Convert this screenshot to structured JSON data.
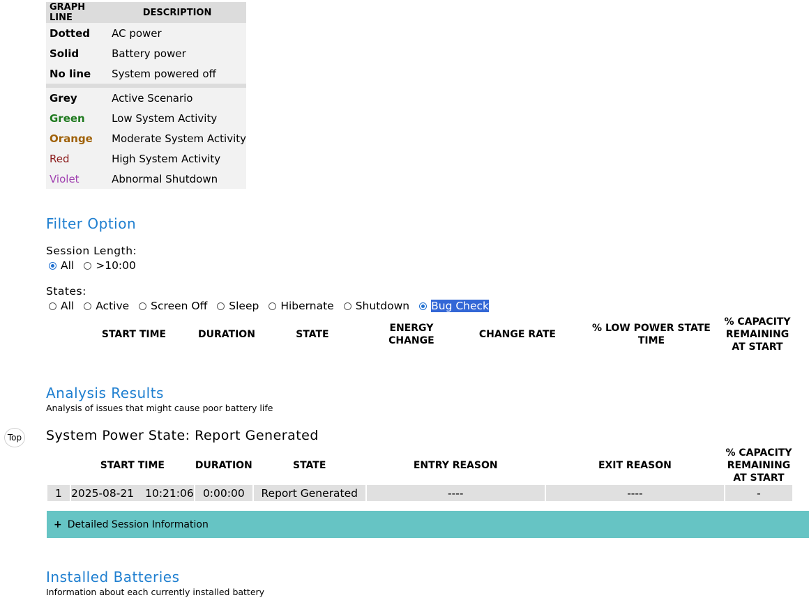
{
  "legend": {
    "headers": [
      "GRAPH LINE",
      "DESCRIPTION"
    ],
    "line_rows": [
      {
        "key": "Dotted",
        "desc": "AC power",
        "color": "#000000"
      },
      {
        "key": "Solid",
        "desc": "Battery power",
        "color": "#000000"
      },
      {
        "key": "No line",
        "desc": "System powered off",
        "color": "#000000"
      }
    ],
    "color_rows": [
      {
        "key": "Grey",
        "desc": "Active Scenario",
        "color": "#000000",
        "weight": "bold"
      },
      {
        "key": "Green",
        "desc": "Low System Activity",
        "color": "#1f7a1f",
        "weight": "bold"
      },
      {
        "key": "Orange",
        "desc": "Moderate System Activity",
        "color": "#a0620a",
        "weight": "bold"
      },
      {
        "key": "Red",
        "desc": "High System Activity",
        "color": "#8b1a1a",
        "weight": "normal"
      },
      {
        "key": "Violet",
        "desc": "Abnormal Shutdown",
        "color": "#a040b0",
        "weight": "normal"
      }
    ]
  },
  "filter": {
    "title": "Filter Option",
    "session_label": "Session Length:",
    "session_options": [
      {
        "label": "All",
        "selected": true,
        "name": "radio-session-all"
      },
      {
        "label": ">10:00",
        "selected": false,
        "name": "radio-session-over-10"
      }
    ],
    "states_label": "States:",
    "state_options": [
      {
        "label": "All",
        "selected": false,
        "name": "radio-state-all"
      },
      {
        "label": "Active",
        "selected": false,
        "name": "radio-state-active"
      },
      {
        "label": "Screen Off",
        "selected": false,
        "name": "radio-state-screen-off"
      },
      {
        "label": "Sleep",
        "selected": false,
        "name": "radio-state-sleep"
      },
      {
        "label": "Hibernate",
        "selected": false,
        "name": "radio-state-hibernate"
      },
      {
        "label": "Shutdown",
        "selected": false,
        "name": "radio-state-shutdown"
      },
      {
        "label": "Bug Check",
        "selected": true,
        "name": "radio-state-bug-check"
      }
    ]
  },
  "usage_table": {
    "headers": [
      "START TIME",
      "DURATION",
      "STATE",
      "ENERGY CHANGE",
      "CHANGE RATE",
      "% LOW POWER STATE TIME",
      "% CAPACITY REMAINING AT START"
    ]
  },
  "analysis": {
    "title": "Analysis Results",
    "subtitle": "Analysis of issues that might cause poor battery life"
  },
  "top_button": "Top",
  "system_power": {
    "title": "System Power State: Report Generated",
    "headers": [
      "START TIME",
      "DURATION",
      "STATE",
      "ENTRY REASON",
      "EXIT REASON",
      "% CAPACITY REMAINING AT START"
    ],
    "rows": [
      {
        "index": "1",
        "date": "2025-08-21",
        "time": "10:21:06",
        "duration": "0:00:00",
        "state": "Report Generated",
        "entry": "----",
        "exit": "----",
        "capacity": "-"
      }
    ]
  },
  "details": {
    "icon": "+",
    "label": "Detailed Session Information",
    "color": "#66c4c4"
  },
  "batteries": {
    "title": "Installed Batteries",
    "subtitle": "Information about each currently installed battery"
  }
}
